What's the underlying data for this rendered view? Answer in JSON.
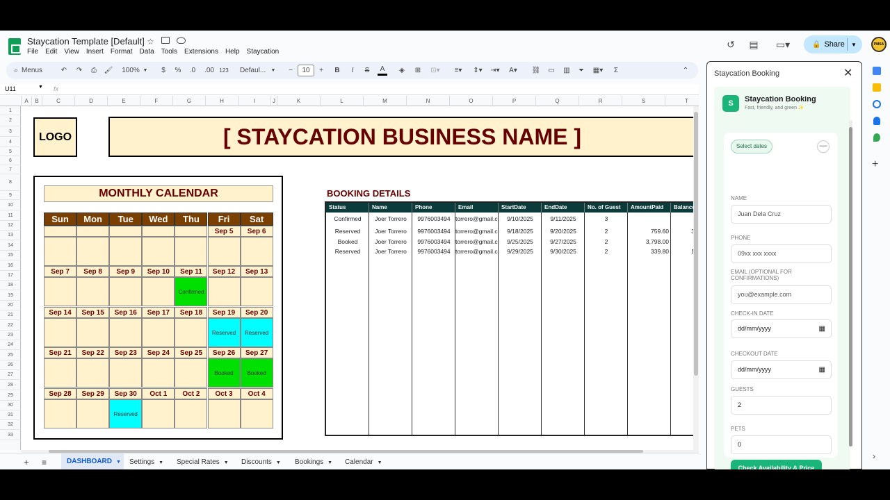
{
  "app": {
    "title": "Staycation Template [Default]",
    "menu": [
      "File",
      "Edit",
      "View",
      "Insert",
      "Format",
      "Data",
      "Tools",
      "Extensions",
      "Help",
      "Staycation"
    ],
    "share_label": "Share",
    "avatar_text": "PMSA"
  },
  "toolbar": {
    "menus_label": "Menus",
    "zoom": "100%",
    "currency": "$",
    "percent": "%",
    "dec_less": ".0",
    "dec_more": ".00",
    "num_format": "123",
    "font": "Defaul...",
    "font_size": "10"
  },
  "formula": {
    "cell_ref": "U11",
    "fx": "fx"
  },
  "columns": [
    "A",
    "B",
    "C",
    "D",
    "E",
    "F",
    "G",
    "H",
    "I",
    "J",
    "K",
    "L",
    "M",
    "N",
    "O",
    "P",
    "Q",
    "R",
    "S",
    "T"
  ],
  "rows": [
    "1",
    "2",
    "3",
    "4",
    "5",
    "6",
    "7",
    "8",
    "9",
    "10",
    "11",
    "12",
    "13",
    "14",
    "15",
    "16",
    "17",
    "18",
    "19",
    "20",
    "21",
    "22",
    "23",
    "24",
    "25",
    "26",
    "27",
    "28",
    "29",
    "30",
    "31",
    "32",
    "33"
  ],
  "sheet": {
    "logo": "LOGO",
    "business_name": "[ STAYCATION BUSINESS NAME ]"
  },
  "calendar": {
    "title": "MONTHLY CALENDAR",
    "days": [
      "Sun",
      "Mon",
      "Tue",
      "Wed",
      "Thu",
      "Fri",
      "Sat"
    ],
    "weeks": [
      [
        "",
        "",
        "",
        "",
        "",
        "Sep 5",
        "Sep 6"
      ],
      [
        "Sep 7",
        "Sep 8",
        "Sep 9",
        "Sep 10",
        "Sep 11",
        "Sep 12",
        "Sep 13"
      ],
      [
        "Sep 14",
        "Sep 15",
        "Sep 16",
        "Sep 17",
        "Sep 18",
        "Sep 19",
        "Sep 20"
      ],
      [
        "Sep 21",
        "Sep 22",
        "Sep 23",
        "Sep 24",
        "Sep 25",
        "Sep 26",
        "Sep 27"
      ],
      [
        "Sep 28",
        "Sep 29",
        "Sep 30",
        "Oct 1",
        "Oct 2",
        "Oct 3",
        "Oct 4"
      ]
    ],
    "events": [
      {
        "week": 1,
        "day": 4,
        "label": "Confirmed",
        "color": "#00e000"
      },
      {
        "week": 2,
        "day": 5,
        "label": "Reserved",
        "color": "#00ffff"
      },
      {
        "week": 2,
        "day": 6,
        "label": "Reserved",
        "color": "#00ffff"
      },
      {
        "week": 3,
        "day": 5,
        "label": "Booked",
        "color": "#00e000"
      },
      {
        "week": 3,
        "day": 6,
        "label": "Booked",
        "color": "#00e000"
      },
      {
        "week": 4,
        "day": 2,
        "label": "Reserved",
        "color": "#00ffff"
      }
    ]
  },
  "booking": {
    "title": "BOOKING DETAILS",
    "headers": [
      "Status",
      "Name",
      "Phone",
      "Email",
      "StartDate",
      "EndDate",
      "No. of Guest",
      "AmountPaid",
      "Balance"
    ],
    "rows": [
      [
        "Confirmed",
        "Joer Torrero",
        "9976003494",
        "torrero@gmail.c",
        "9/10/2025",
        "9/11/2025",
        "3",
        "",
        ""
      ],
      [
        "Reserved",
        "Joer Torrero",
        "9976003494",
        "torrero@gmail.c",
        "9/18/2025",
        "9/20/2025",
        "2",
        "759.60",
        "3,0"
      ],
      [
        "Booked",
        "Joer Torrero",
        "9976003494",
        "torrero@gmail.c",
        "9/25/2025",
        "9/27/2025",
        "2",
        "3,798.00",
        ""
      ],
      [
        "Reserved",
        "Joer Torrero",
        "9976003494",
        "torrero@gmail.c",
        "9/29/2025",
        "9/30/2025",
        "2",
        "339.80",
        "1,3"
      ]
    ]
  },
  "tabs": [
    "DASHBOARD",
    "Settings",
    "Special Rates",
    "Discounts",
    "Bookings",
    "Calendar"
  ],
  "panel": {
    "title": "Staycation Booking",
    "brand_letter": "S",
    "brand_name": "Staycation Booking",
    "brand_tagline": "Fast, friendly, and green ✨",
    "select_dates": "Select dates",
    "name_label": "NAME",
    "name_placeholder": "Juan Dela Cruz",
    "phone_label": "PHONE",
    "phone_placeholder": "09xx xxx xxxx",
    "email_label": "EMAIL (OPTIONAL FOR CONFIRMATIONS)",
    "email_placeholder": "you@example.com",
    "checkin_label": "CHECK-IN DATE",
    "checkin_placeholder": "dd/mm/yyyy",
    "checkout_label": "CHECKOUT DATE",
    "checkout_placeholder": "dd/mm/yyyy",
    "guests_label": "GUESTS",
    "guests_value": "2",
    "pets_label": "PETS",
    "pets_value": "0",
    "check_button": "Check Availability & Price"
  }
}
